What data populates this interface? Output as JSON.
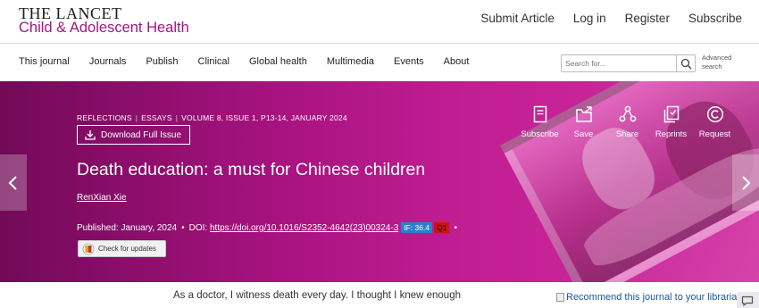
{
  "brand": {
    "logo_line1": "THE LANCET",
    "logo_line2": "Child & Adolescent Health",
    "links": [
      "Submit Article",
      "Log in",
      "Register",
      "Subscribe"
    ]
  },
  "nav": {
    "items": [
      "This journal",
      "Journals",
      "Publish",
      "Clinical",
      "Global health",
      "Multimedia",
      "Events",
      "About"
    ],
    "search_placeholder": "Search for...",
    "advanced_search_line1": "Advanced",
    "advanced_search_line2": "search"
  },
  "article": {
    "category1": "REFLECTIONS",
    "category2": "ESSAYS",
    "issue_info": "VOLUME 8, ISSUE 1, P13-14, JANUARY 2024",
    "download_label": "Download Full Issue",
    "title": "Death education: a must for Chinese children",
    "author": "RenXian Xie",
    "published_label": "Published:",
    "published_date": "January, 2024",
    "doi_label": "DOI:",
    "doi": "https://doi.org/10.1016/S2352-4642(23)00324-3",
    "if_badge": "IF: 36.4",
    "q_badge": "Q1",
    "check_updates_label": "Check for updates"
  },
  "actions": [
    {
      "label": "Subscribe",
      "icon": "document-icon"
    },
    {
      "label": "Save",
      "icon": "folder-save-icon"
    },
    {
      "label": "Share",
      "icon": "share-icon"
    },
    {
      "label": "Reprints",
      "icon": "reprints-icon"
    },
    {
      "label": "Request",
      "icon": "copyright-icon"
    }
  ],
  "body": {
    "first_line": "As a doctor, I witness death every day. I thought I knew enough",
    "recommend_link": "Recommend this journal to your librarian"
  },
  "colors": {
    "brand_magenta": "#a3157d",
    "hero_start": "#720a57",
    "hero_end": "#d02ea0",
    "if_badge": "#2b7fcf",
    "q_badge": "#d11010"
  }
}
